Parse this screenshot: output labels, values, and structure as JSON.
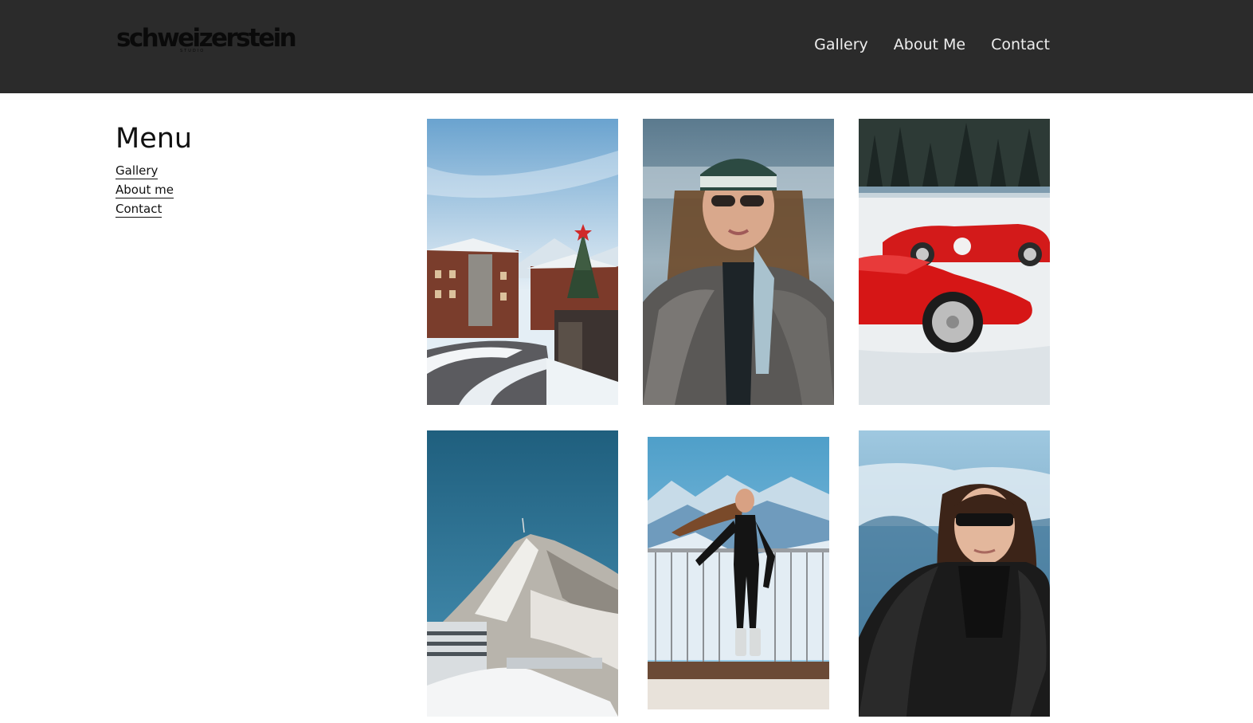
{
  "header": {
    "logo_text": "schweizerstein",
    "logo_subtext": "STUDIO",
    "nav": [
      "Gallery",
      "About Me",
      "Contact"
    ]
  },
  "sidebar": {
    "title": "Menu",
    "links": [
      "Gallery",
      "About me",
      "Contact"
    ]
  },
  "gallery": {
    "photos": [
      {
        "subject": "snowy-village-christmas-tree"
      },
      {
        "subject": "woman-beanie-fur-coat"
      },
      {
        "subject": "red-vintage-race-cars-snow"
      },
      {
        "subject": "snowy-mountain-peak-station"
      },
      {
        "subject": "woman-balcony-alps"
      },
      {
        "subject": "woman-black-fur-mountains"
      }
    ]
  },
  "colors": {
    "header_bg": "#2b2b2b",
    "nav_text": "#eeeeee",
    "page_bg": "#ffffff",
    "text": "#111111"
  }
}
